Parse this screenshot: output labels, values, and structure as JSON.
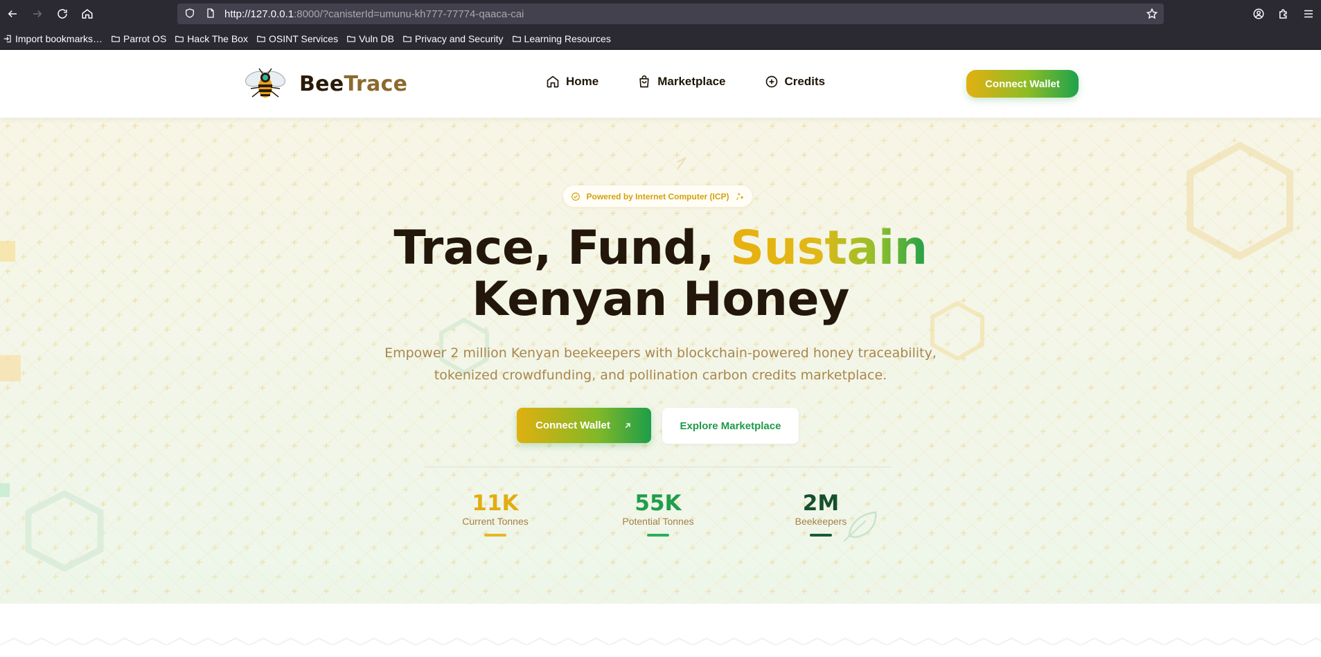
{
  "browser": {
    "url_host": "http://127.0.0.1",
    "url_rest": ":8000/?canisterId=umunu-kh777-77774-qaaca-cai",
    "bookmarks": [
      "Import bookmarks…",
      "Parrot OS",
      "Hack The Box",
      "OSINT Services",
      "Vuln DB",
      "Privacy and Security",
      "Learning Resources"
    ]
  },
  "header": {
    "brand_part1": "Bee",
    "brand_part2": "Trace",
    "nav": [
      {
        "label": "Home",
        "icon": "home-icon"
      },
      {
        "label": "Marketplace",
        "icon": "shopping-bag-icon"
      },
      {
        "label": "Credits",
        "icon": "plus-circle-icon"
      }
    ],
    "connect_wallet": "Connect Wallet"
  },
  "hero": {
    "badge": "Powered by Internet Computer (ICP)",
    "headline_line1_plain": "Trace, Fund, ",
    "headline_line1_accent": "Sustain",
    "headline_line2": "Kenyan Honey",
    "subtitle_line1": "Empower 2 million Kenyan beekeepers with blockchain-powered honey traceability,",
    "subtitle_line2": "tokenized crowdfunding, and pollination carbon credits marketplace.",
    "primary_button": "Connect Wallet",
    "secondary_button": "Explore Marketplace",
    "stats": [
      {
        "value": "11K",
        "label": "Current Tonnes",
        "color": "#e2ad12"
      },
      {
        "value": "55K",
        "label": "Potential Tonnes",
        "color": "#1f9e4b"
      },
      {
        "value": "2M",
        "label": "Beekeepers",
        "color": "#14502c"
      }
    ]
  },
  "colors": {
    "honey": "#e2ad12",
    "green": "#1f9e4b",
    "dark_green": "#14502c",
    "text_dark": "#22170a",
    "text_muted": "#a8864d"
  }
}
